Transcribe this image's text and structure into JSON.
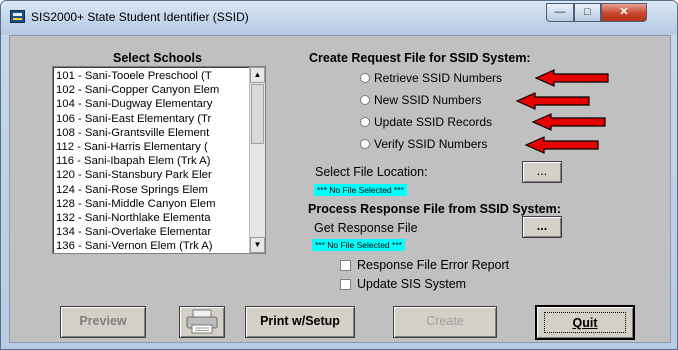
{
  "window": {
    "title": "SIS2000+ State Student Identifier (SSID)",
    "icon": "app-window-icon",
    "controls": {
      "minimize": "—",
      "maximize": "□",
      "close": "✕"
    }
  },
  "schools": {
    "heading": "Select Schools",
    "items": [
      "101 - Sani-Tooele Preschool (T",
      "102 - Sani-Copper Canyon Elem",
      "104 - Sani-Dugway Elementary",
      "106 - Sani-East Elementary (Tr",
      "108 - Sani-Grantsville Element",
      "112 - Sani-Harris Elementary (",
      "116 - Sani-Ibapah Elem (Trk A)",
      "120 - Sani-Stansbury Park Eler",
      "124 - Sani-Rose Springs Elem",
      "128 - Sani-Middle Canyon Elem",
      "132 - Sani-Northlake Elementa",
      "134 - Sani-Overlake Elementar",
      "136 - Sani-Vernon Elem (Trk A)"
    ],
    "scroll_up": "▲",
    "scroll_down": "▼"
  },
  "request": {
    "heading": "Create Request File for SSID System:",
    "options": [
      "Retrieve SSID Numbers",
      "New SSID Numbers",
      "Update SSID Records",
      "Verify SSID Numbers"
    ],
    "annotation_color": "#e60000",
    "select_location_label": "Select File Location:",
    "browse_label": "...",
    "status": "*** No File Selected ***",
    "status_color": "#00ffff"
  },
  "response": {
    "heading": "Process Response File from SSID System:",
    "get_label": "Get Response File",
    "browse_label": "...",
    "status": "*** No File Selected ***",
    "error_report_label": "Response File Error Report",
    "update_sis_label": "Update SIS System"
  },
  "buttons": {
    "preview": "Preview",
    "printer_icon": "printer-icon",
    "print_setup": "Print w/Setup",
    "create": "Create",
    "quit": "Quit"
  }
}
